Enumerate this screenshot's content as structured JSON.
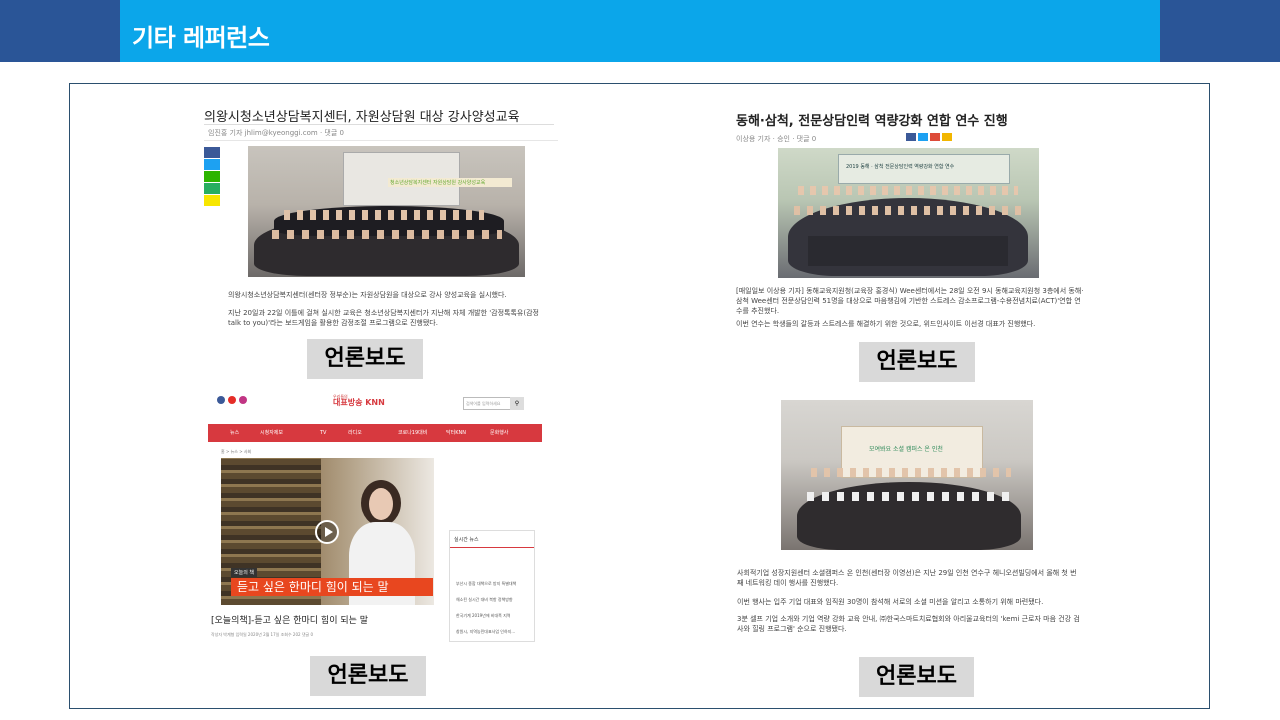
{
  "page": {
    "title": "기타 레퍼런스"
  },
  "tag_label": "언론보도",
  "articles": [
    {
      "headline": "의왕시청소년상담복지센터, 자원상담원 대상 강사양성교육",
      "meta": "임진홍 기자 jhlim@kyeonggi.com    ·    댓글 0",
      "body": [
        "의왕시청소년상담복지센터(센터장 정부순)는 자원상담원을 대상으로 강사 양성교육을 실시했다.",
        "지난 20일과 22일 이틀에 걸쳐 실시한 교육은 청소년상담복지센터가 지난해 자체 개발한 '감정톡톡유(감정 talk to you)'라는 보드게임을 활용한 감정조절 프로그램으로 진행됐다."
      ],
      "banner": "청소년상담복지센터 자원상담원 강사양성교육"
    },
    {
      "headline": "동해·삼척, 전문상담인력 역량강화 연합 연수 진행",
      "meta": "이상용 기자  ·  승인  ·  댓글 0",
      "body": [
        "[매일일보 이상용 기자] 동해교육지원청(교육장 홍경식) Wee센터에서는 28일 오전 9시 동해교육지원청 3층에서 동해·삼척 Wee센터 전문상담인력 51명을 대상으로 마음챙김에 기반한 스트레스 감소프로그램-수용전념치료(ACT)'연합 연수를 추진했다.",
        "이번 연수는 학생들의 갈등과 스트레스를 해결하기 위한 것으로, 위드인사이트 이선경 대표가 진행했다."
      ],
      "banner": "2019 동해 · 삼척 전문상담인력 역량강화 연합 연수"
    },
    {
      "logo_small": "우리들의",
      "logo_brand": "대표방송 KNN",
      "search_placeholder": "검색어를 입력하세요",
      "nav": [
        "뉴스",
        "시청자제보",
        "TV",
        "라디오",
        "코로나19대비",
        "닥터KNN",
        "문화행사"
      ],
      "breadcrumb": "홈 > 뉴스 > 사회",
      "video_badge": "오늘의 책",
      "video_caption": "듣고 싶은 한마디 힘이 되는 말",
      "headline": "[오늘의책]-듣고 싶은 한마디 힘이 되는 말",
      "meta": "작성자 박계형  입력일 2020년 2월 17일  조회수 202  댓글 0",
      "side_title": "실시간 뉴스",
      "side_items": [
        "부산시 종합 대책으로 방지 특별대책",
        "해소된 실시간 대비 북항 정책방향",
        "한국기계 2019년에 비대폭 지역",
        "창원시, 지역농민대표사업 인하지..."
      ]
    },
    {
      "body": [
        "사회적기업 성장지원센터 소셜캠퍼스 온 인천(센터장 이영선)은 지난 29일 인천 연수구 헤니오션빌딩에서 올해 첫 번째 네트워킹 데이 행사를 진행했다.",
        "이번 행사는 입주 기업 대표와 임직원 30명이 참석해 서로의 소셜 미션을 알리고 소통하기 위해 마련됐다.",
        "3분 셀프 기업 소개와 기업 역량 강화 교육 안내, ㈜한국스마트치료협회와 아리울교육터의 'kemi 근로자 마음 건강 검사와 힐링 프로그램' 순으로 진행됐다."
      ],
      "banner": "모여봐요 소셜 캠퍼스 온 인천"
    }
  ],
  "colors": {
    "top_bar": "#2a5597",
    "title_band": "#0ba6ea",
    "knn_red": "#d7393f"
  }
}
